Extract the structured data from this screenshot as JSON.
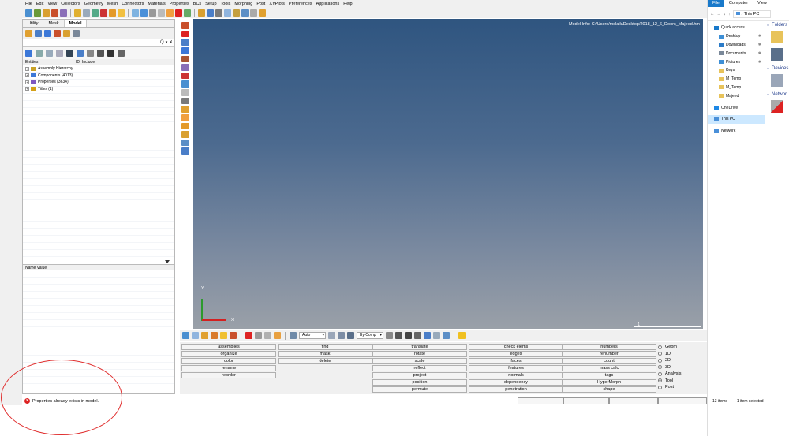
{
  "menubar": [
    "File",
    "Edit",
    "View",
    "Collectors",
    "Geometry",
    "Mesh",
    "Connectors",
    "Materials",
    "Properties",
    "BCs",
    "Setup",
    "Tools",
    "Morphing",
    "Post",
    "XYPlots",
    "Preferences",
    "Applications",
    "Help"
  ],
  "browser": {
    "tabs": [
      "Utility",
      "Mask",
      "Model"
    ],
    "active_tab": "Model",
    "search_icon_glyph": "Q",
    "search_dropdown_glyph": "▾",
    "search_filter_glyph": "¥",
    "header": {
      "entities": "Entities",
      "id": "ID",
      "include": "Include"
    },
    "tree": [
      {
        "label": "Assembly Hierarchy",
        "color": "#c9a227"
      },
      {
        "label": "Components (4013)",
        "color": "#3c78d8"
      },
      {
        "label": "Properties (3634)",
        "color": "#7e57c2"
      },
      {
        "label": "Titles (1)",
        "color": "#d4a017"
      }
    ],
    "name_value_header": "Name Value"
  },
  "graphics": {
    "model_info": "Model Info: C:/Users/mslaik/Desktop/2018_12_6_Doors_Majeed.hm",
    "axis_y": "Y",
    "axis_x": "X",
    "scale_label": "1"
  },
  "bottom_toolbar": {
    "select1": "Auto",
    "select2": "By Comp"
  },
  "panel": {
    "col1": [
      "assemblies",
      "organize",
      "color",
      "rename",
      "reorder"
    ],
    "col2": [
      "find",
      "mask",
      "delete"
    ],
    "col3": [
      "translate",
      "rotate",
      "scale",
      "reflect",
      "project",
      "position",
      "permute"
    ],
    "col4": [
      "check elems",
      "edges",
      "faces",
      "features",
      "normals",
      "dependency",
      "penetration"
    ],
    "col5": [
      "numbers",
      "renumber",
      "count",
      "mass calc",
      "tags",
      "HyperMorph",
      "shape"
    ],
    "radios": [
      "Geom",
      "1D",
      "2D",
      "3D",
      "Analysis",
      "Tool",
      "Post"
    ],
    "selected_radio": "Tool"
  },
  "status": {
    "error_glyph": "×",
    "message": "Properties already exists in model."
  },
  "explorer": {
    "tabs": [
      "File",
      "Computer",
      "View"
    ],
    "nav_arrows": [
      "←",
      "→",
      "↓",
      "↑"
    ],
    "path_sep": "›",
    "path": "This PC",
    "nav": [
      {
        "label": "Quick access",
        "top": true,
        "color": "#1979ca"
      },
      {
        "label": "Desktop",
        "pinned": true,
        "color": "#3d8fd6"
      },
      {
        "label": "Downloads",
        "pinned": true,
        "color": "#2b7bc8"
      },
      {
        "label": "Documents",
        "pinned": true,
        "color": "#7a8899"
      },
      {
        "label": "Pictures",
        "pinned": true,
        "color": "#3d8fd6"
      },
      {
        "label": "Keys",
        "color": "#e8c35a"
      },
      {
        "label": "M_Temp",
        "color": "#e8c35a"
      },
      {
        "label": "M_Temp",
        "color": "#e8c35a"
      },
      {
        "label": "Majeed",
        "color": "#e8c35a"
      },
      {
        "label": "OneDrive",
        "top": true,
        "color": "#1e88e5"
      },
      {
        "label": "This PC",
        "top": true,
        "selected": true,
        "color": "#4a90d9"
      },
      {
        "label": "Network",
        "top": true,
        "color": "#4a90d9"
      }
    ],
    "pin_glyph": "✱",
    "folders": "Folders",
    "devices": "Devices",
    "network": "Networ",
    "items_count": "13 items",
    "selected_count": "1 item selected"
  }
}
